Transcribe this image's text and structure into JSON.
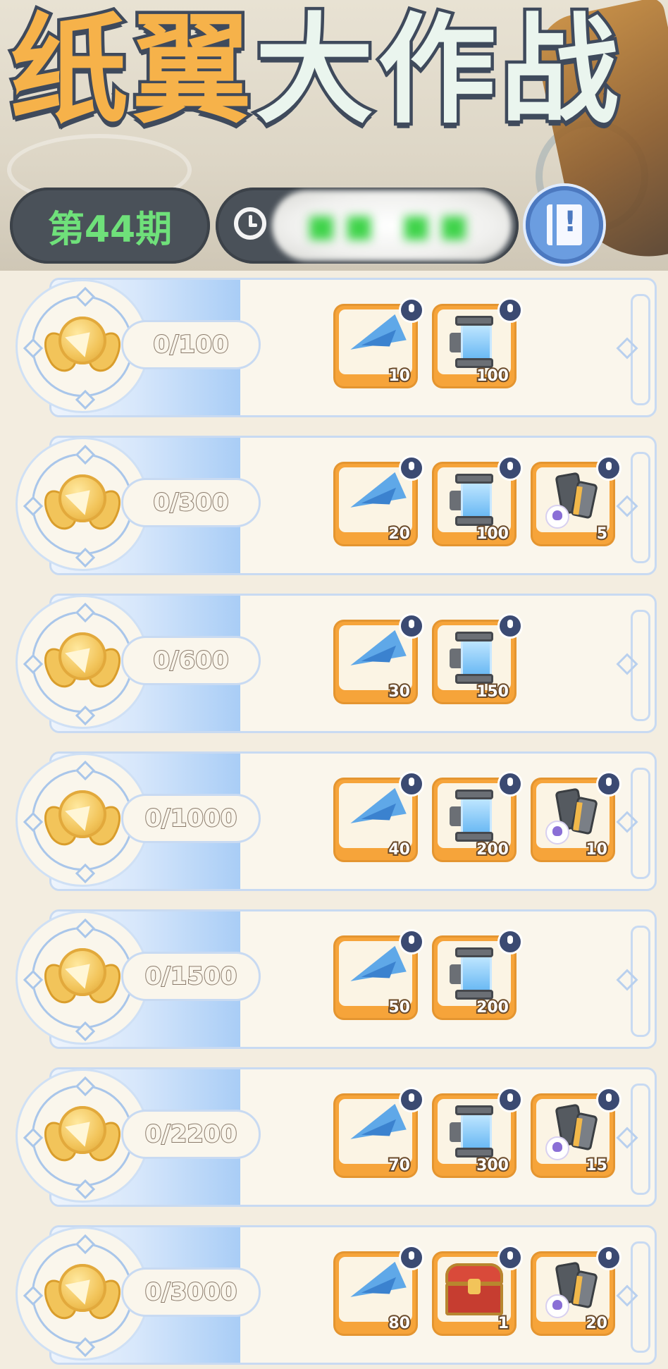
{
  "header": {
    "title_part1": "纸翼",
    "title_part2": "大作战",
    "issue_label": "第44期",
    "timer_value": "■■ ■■",
    "timer_icon": "clock-icon",
    "rules_icon": "book-icon"
  },
  "colors": {
    "title_orange": "#f6b24a",
    "title_white": "#eaf5ee",
    "issue_green": "#6fe07a",
    "reward_frame": "#f6a43a",
    "stripe_blue": "#a9cdf6"
  },
  "tiers": [
    {
      "progress": "0/100",
      "rewards": [
        {
          "type": "plane",
          "count": "10"
        },
        {
          "type": "tube",
          "count": "100"
        }
      ]
    },
    {
      "progress": "0/300",
      "rewards": [
        {
          "type": "plane",
          "count": "20"
        },
        {
          "type": "tube",
          "count": "100"
        },
        {
          "type": "ore",
          "count": "5"
        }
      ]
    },
    {
      "progress": "0/600",
      "rewards": [
        {
          "type": "plane",
          "count": "30"
        },
        {
          "type": "tube",
          "count": "150"
        }
      ]
    },
    {
      "progress": "0/1000",
      "rewards": [
        {
          "type": "plane",
          "count": "40"
        },
        {
          "type": "tube",
          "count": "200"
        },
        {
          "type": "ore",
          "count": "10"
        }
      ]
    },
    {
      "progress": "0/1500",
      "rewards": [
        {
          "type": "plane",
          "count": "50"
        },
        {
          "type": "tube",
          "count": "200"
        }
      ]
    },
    {
      "progress": "0/2200",
      "rewards": [
        {
          "type": "plane",
          "count": "70"
        },
        {
          "type": "tube",
          "count": "300"
        },
        {
          "type": "ore",
          "count": "15"
        }
      ]
    },
    {
      "progress": "0/3000",
      "rewards": [
        {
          "type": "plane",
          "count": "80"
        },
        {
          "type": "chest",
          "count": "1"
        },
        {
          "type": "ore",
          "count": "20"
        }
      ]
    }
  ]
}
